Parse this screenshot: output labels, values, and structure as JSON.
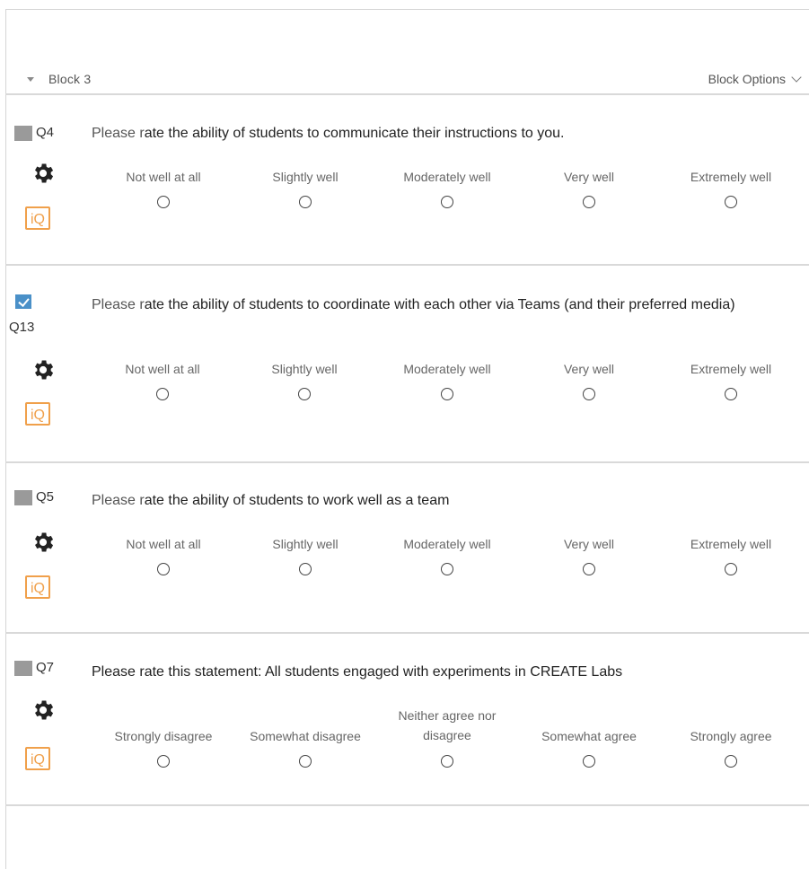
{
  "block": {
    "title": "Block 3",
    "options_label": "Block Options"
  },
  "questions": [
    {
      "id": "Q4",
      "checked": false,
      "lead": "Please r",
      "text": "ate the ability of students to communicate their instructions to you.",
      "options": [
        "Not well at all",
        "Slightly well",
        "Moderately well",
        "Very well",
        "Extremely well"
      ]
    },
    {
      "id": "Q13",
      "checked": true,
      "lead": "Please r",
      "text": "ate the ability of students to coordinate with each other via Teams (and their preferred media)",
      "options": [
        "Not well at all",
        "Slightly well",
        "Moderately well",
        "Very well",
        "Extremely well"
      ]
    },
    {
      "id": "Q5",
      "checked": false,
      "lead": "Please r",
      "text": "ate the ability of students to work well as a team",
      "options": [
        "Not well at all",
        "Slightly well",
        "Moderately well",
        "Very well",
        "Extremely well"
      ]
    },
    {
      "id": "Q7",
      "checked": false,
      "lead": "",
      "text": "Please rate this statement: All students engaged with experiments in CREATE Labs",
      "options": [
        "Strongly disagree",
        "Somewhat disagree",
        "Neither agree nor disagree",
        "Somewhat agree",
        "Strongly agree"
      ]
    }
  ],
  "icons": {
    "gear": "gear-icon",
    "iq": "iQ",
    "caret": "caret-down-icon",
    "chevron": "chevron-down-icon"
  },
  "colors": {
    "iq_accent": "#f0a04b",
    "checkbox_checked": "#4a90c8"
  }
}
